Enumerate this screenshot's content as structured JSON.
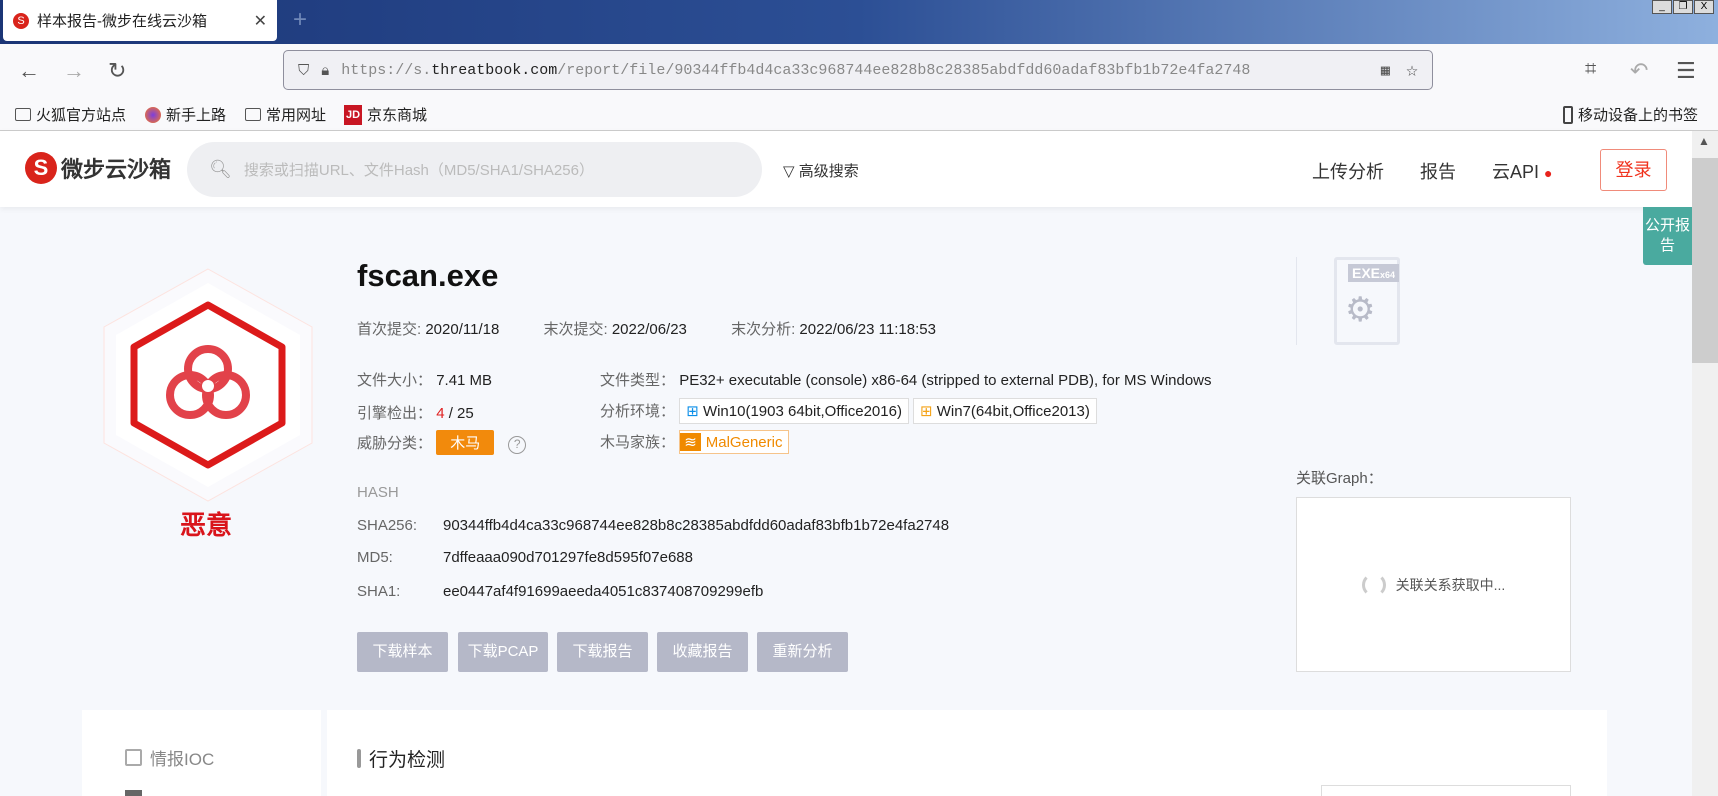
{
  "browser": {
    "tab_title": "样本报告-微步在线云沙箱",
    "url_prefix": "https://s.",
    "url_domain": "threatbook.com",
    "url_path": "/report/file/90344ffb4d4ca33c968744ee828b8c28385abdfdd60adaf83bfb1b72e4fa2748",
    "bookmarks": [
      "火狐官方站点",
      "新手上路",
      "常用网址",
      "京东商城"
    ],
    "mobile_bookmarks": "移动设备上的书签"
  },
  "header": {
    "logo_text": "微步云沙箱",
    "search_placeholder": "搜索或扫描URL、文件Hash（MD5/SHA1/SHA256）",
    "advanced_search": "高级搜索",
    "nav": [
      "上传分析",
      "报告",
      "云API"
    ],
    "login": "登录",
    "public_report": "公开报告"
  },
  "report": {
    "verdict": "恶意",
    "filename": "fscan.exe",
    "first_submit_label": "首次提交:",
    "first_submit": "2020/11/18",
    "last_submit_label": "末次提交:",
    "last_submit": "2022/06/23",
    "last_analysis_label": "末次分析:",
    "last_analysis": "2022/06/23 11:18:53",
    "size_label": "文件大小：",
    "size": "7.41 MB",
    "type_label": "文件类型：",
    "type": "PE32+ executable (console) x86-64 (stripped to external PDB), for MS Windows",
    "engine_label": "引擎检出：",
    "engine_hits": "4",
    "engine_total": "/ 25",
    "env_label": "分析环境：",
    "envs": [
      "Win10(1903 64bit,Office2016)",
      "Win7(64bit,Office2013)"
    ],
    "threat_label": "威胁分类：",
    "threat": "木马",
    "family_label": "木马家族：",
    "family": "MalGeneric",
    "hash_title": "HASH",
    "sha256_label": "SHA256:",
    "sha256": "90344ffb4d4ca33c968744ee828b8c28385abdfdd60adaf83bfb1b72e4fa2748",
    "md5_label": "MD5:",
    "md5": "7dffeaaa090d701297fe8d595f07e688",
    "sha1_label": "SHA1:",
    "sha1": "ee0447af4f91699aeeda4051c837408709299efb",
    "buttons": [
      "下载样本",
      "下载PCAP",
      "下载报告",
      "收藏报告",
      "重新分析"
    ],
    "file_icon": "EXE",
    "file_arch": "x64",
    "graph_label": "关联Graph：",
    "graph_loading": "关联关系获取中..."
  },
  "bottom": {
    "side_item": "情报IOC",
    "section_title": "行为检测"
  },
  "colors": {
    "accent": "#d9241b",
    "teal": "#4aaa9f",
    "orange": "#f28a0c"
  }
}
